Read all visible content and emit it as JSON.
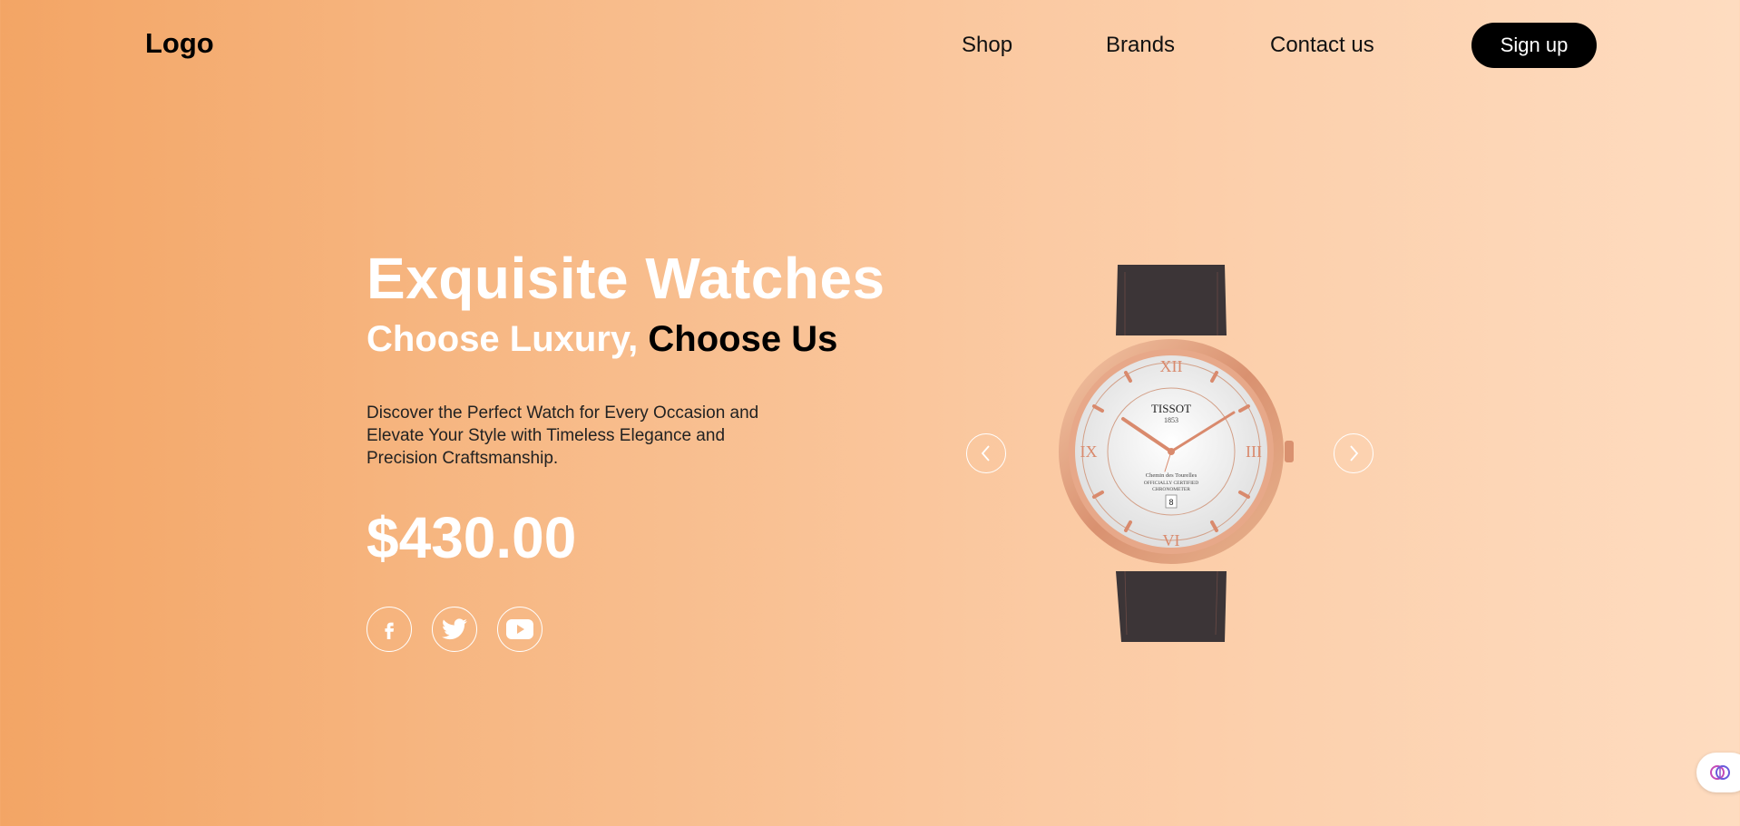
{
  "header": {
    "logo": "Logo",
    "nav": [
      "Shop",
      "Brands",
      "Contact us"
    ],
    "signup": "Sign up"
  },
  "hero": {
    "title": "Exquisite Watches",
    "subtitle_part1": "Choose Luxury, ",
    "subtitle_part2": "Choose Us",
    "description": "Discover the Perfect Watch for Every Occasion and Elevate Your Style with Timeless Elegance and Precision Craftsmanship.",
    "price": "$430.00"
  },
  "product": {
    "brand": "TISSOT",
    "year": "1853",
    "dial_text": [
      "Chemin des Tourelles",
      "OFFICIALLY CERTIFIED",
      "CHRONOMETER"
    ],
    "date": "8"
  },
  "social": [
    "facebook-icon",
    "twitter-icon",
    "youtube-icon"
  ],
  "carousel": {
    "prev": "chevron-left-icon",
    "next": "chevron-right-icon"
  },
  "colors": {
    "accent": "#f3a565",
    "button": "#000000",
    "text_light": "#ffffff"
  }
}
